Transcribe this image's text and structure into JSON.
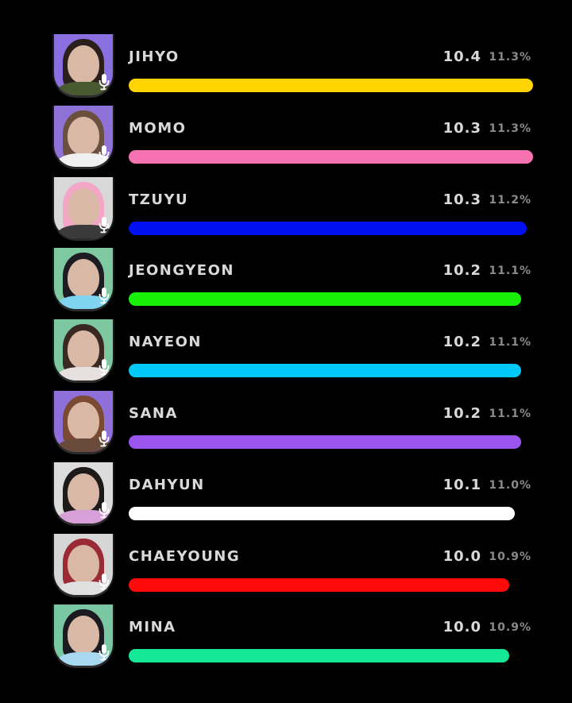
{
  "chart_data": {
    "type": "bar",
    "orientation": "horizontal",
    "title": "",
    "xlabel": "",
    "ylabel": "",
    "categories": [
      "JIHYO",
      "MOMO",
      "TZUYU",
      "JEONGYEON",
      "NAYEON",
      "SANA",
      "DAHYUN",
      "CHAEYOUNG",
      "MINA"
    ],
    "values": [
      10.4,
      10.3,
      10.3,
      10.2,
      10.2,
      10.2,
      10.1,
      10.0,
      10.0
    ],
    "value_labels": [
      "10.4",
      "10.3",
      "10.3",
      "10.2",
      "10.2",
      "10.2",
      "10.1",
      "10.0",
      "10.0"
    ],
    "percentages": [
      "11.3%",
      "11.3%",
      "11.2%",
      "11.1%",
      "11.1%",
      "11.1%",
      "11.0%",
      "10.9%",
      "10.9%"
    ],
    "percent_values": [
      11.3,
      11.3,
      11.2,
      11.1,
      11.1,
      11.1,
      11.0,
      10.9,
      10.9
    ],
    "bar_colors": [
      "#ffd400",
      "#f772b0",
      "#0010f0",
      "#18f00a",
      "#00c8f8",
      "#9a55ee",
      "#ffffff",
      "#ff0a0a",
      "#14e896"
    ],
    "avatar_backgrounds": [
      "#8a6fe0",
      "#8e72d8",
      "#d8d8d8",
      "#7fc9a0",
      "#7dc8a0",
      "#8f6fd9",
      "#dcdcdc",
      "#d6d6d6",
      "#79c7a3"
    ],
    "avatar_icon": "mic-icon",
    "grid": false,
    "legend": "none"
  }
}
